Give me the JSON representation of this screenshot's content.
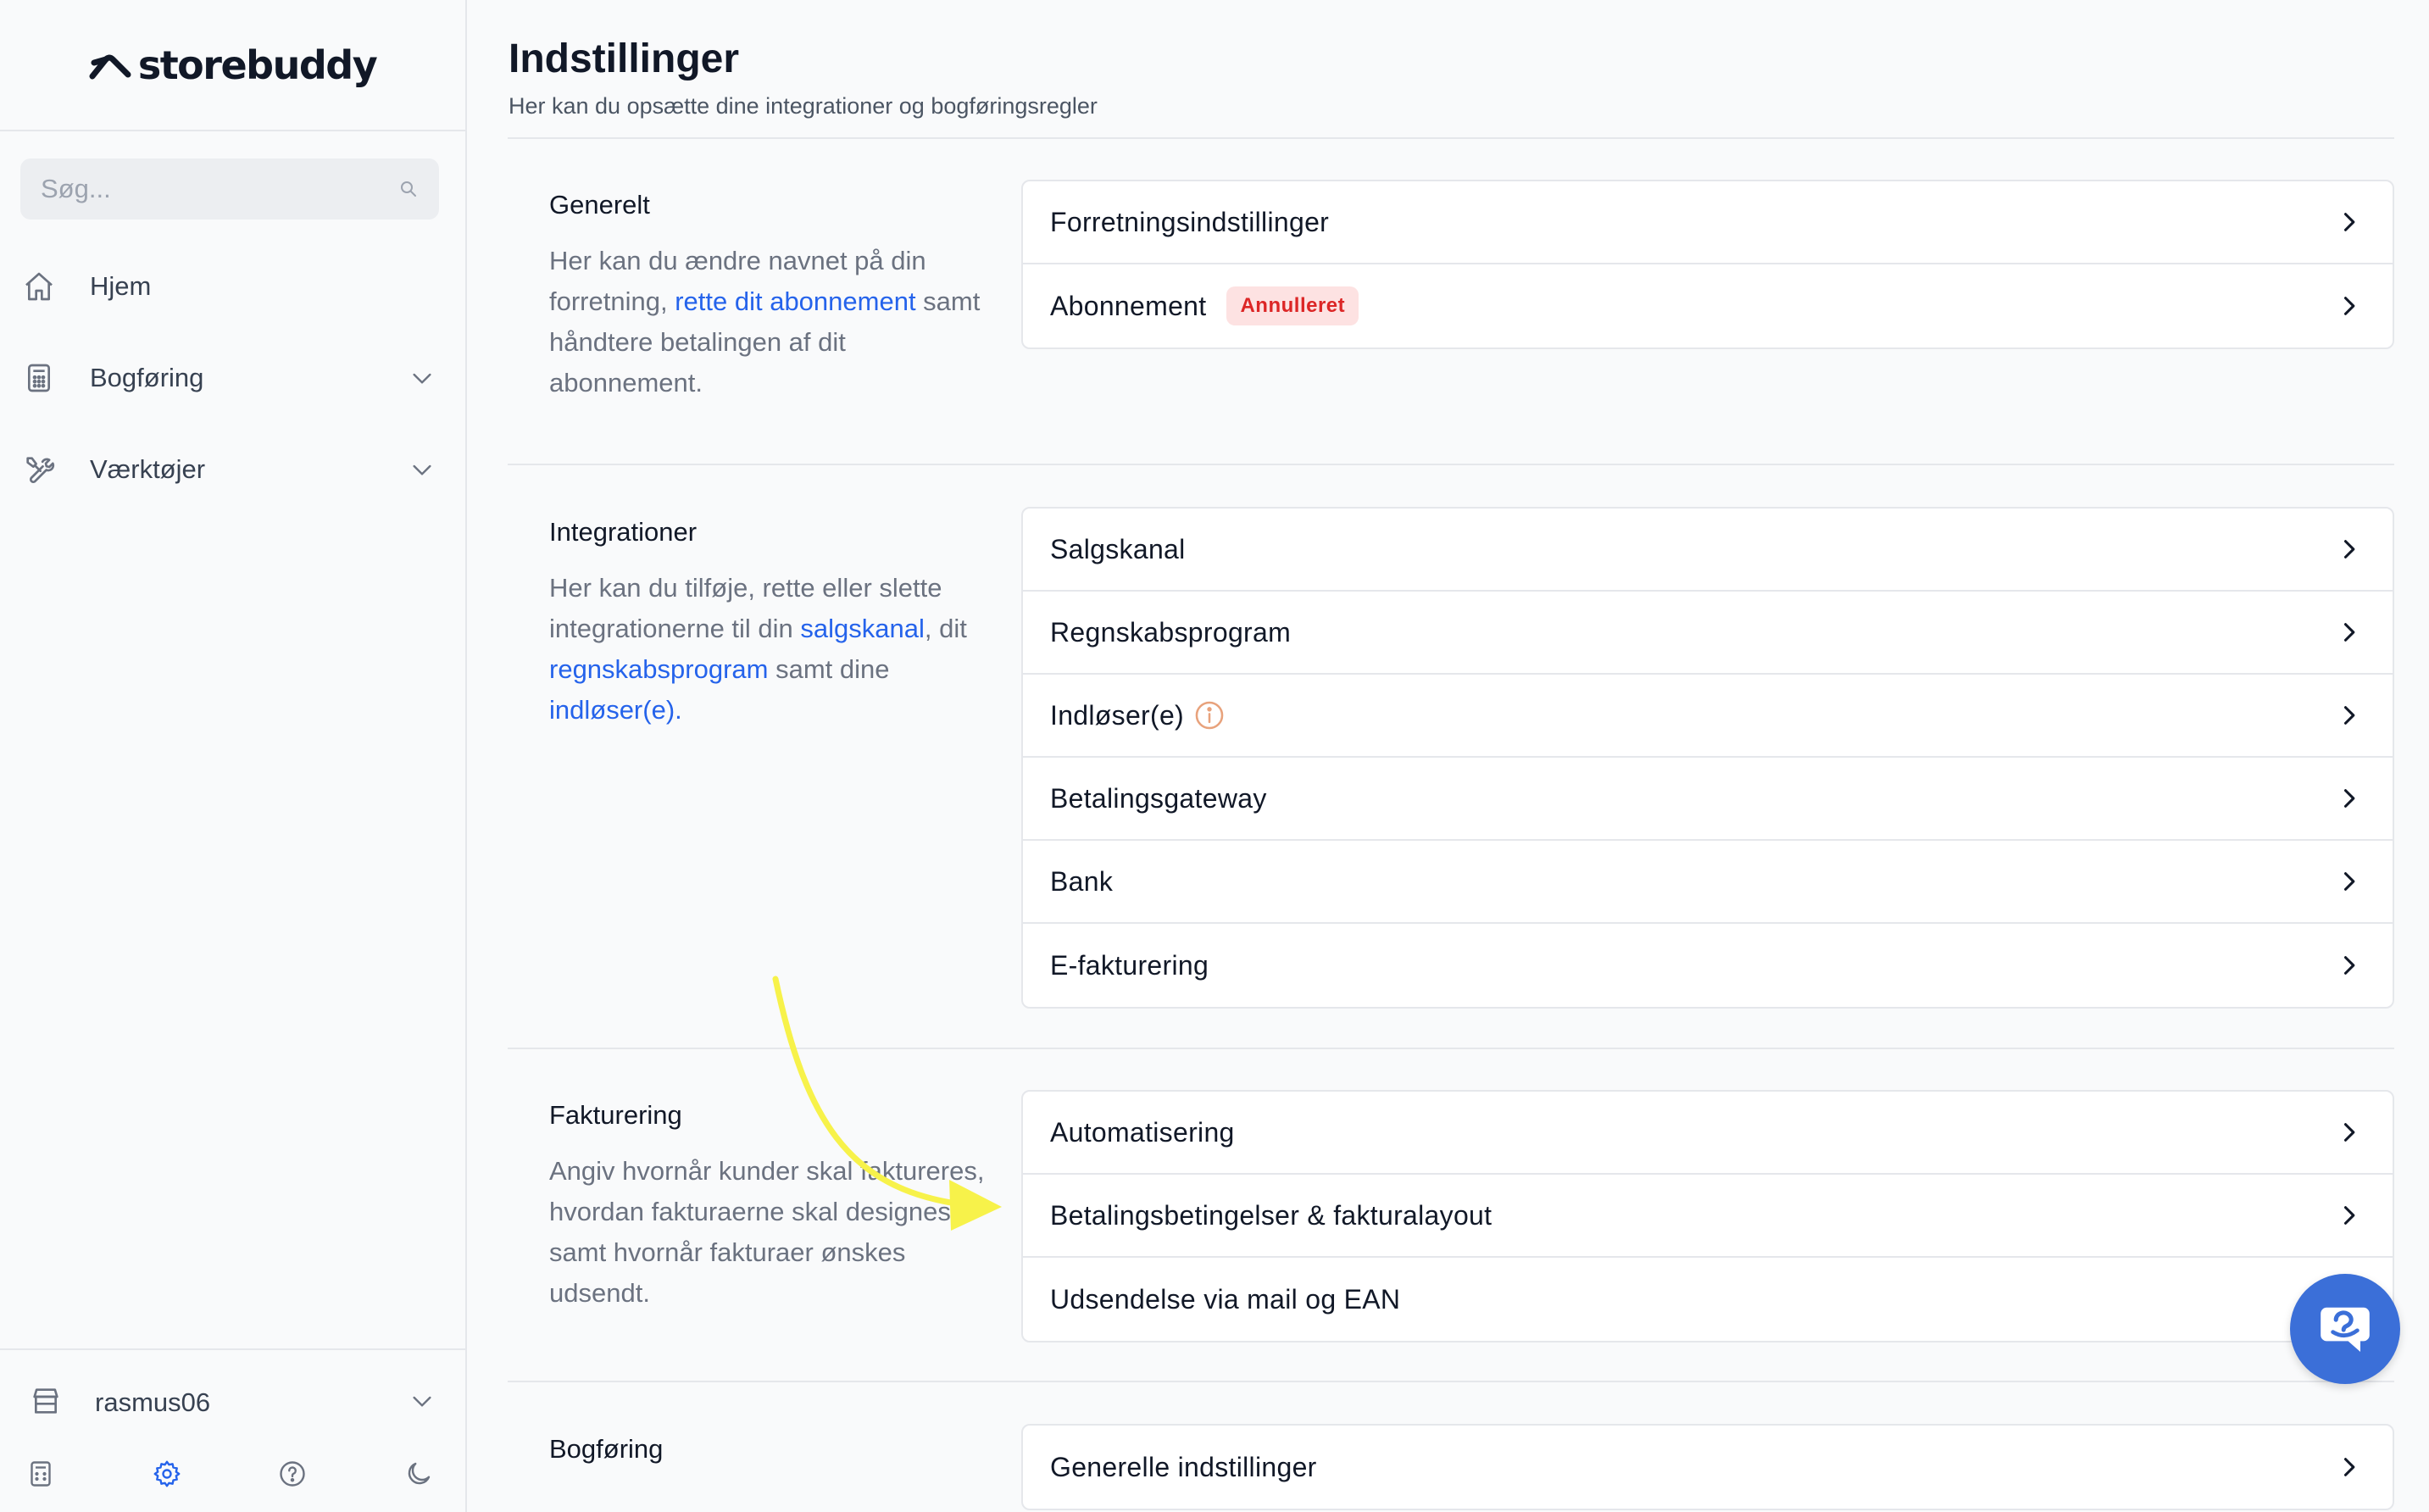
{
  "app": {
    "logo_text": "storebuddy"
  },
  "sidebar": {
    "search_placeholder": "Søg...",
    "nav": [
      {
        "label": "Hjem",
        "icon": "home-icon"
      },
      {
        "label": "Bogføring",
        "icon": "calculator-icon"
      },
      {
        "label": "Værktøjer",
        "icon": "tools-icon"
      }
    ],
    "user": {
      "name": "rasmus06"
    },
    "footer_icons": [
      "calculator-icon",
      "gear-icon",
      "help-icon",
      "moon-icon"
    ]
  },
  "page": {
    "title": "Indstillinger",
    "subtitle": "Her kan du opsætte dine integrationer og bogføringsregler"
  },
  "sections": {
    "generelt": {
      "title": "Generelt",
      "desc_1": "Her kan du ændre navnet på din forretning, ",
      "desc_link": "rette dit abonnement",
      "desc_2": " samt håndtere betalingen af dit abonnement.",
      "rows": [
        {
          "label": "Forretningsindstillinger"
        },
        {
          "label": "Abonnement",
          "badge": "Annulleret"
        }
      ]
    },
    "integrationer": {
      "title": "Integrationer",
      "desc_1": "Her kan du tilføje, rette eller slette integrationerne til din ",
      "link_1": "salgskanal",
      "desc_2": ", dit ",
      "link_2": "regnskabsprogram",
      "desc_3": " samt dine ",
      "link_3": "indløser(e).",
      "rows": [
        {
          "label": "Salgskanal"
        },
        {
          "label": "Regnskabsprogram"
        },
        {
          "label": "Indløser(e)"
        },
        {
          "label": "Betalingsgateway"
        },
        {
          "label": "Bank"
        },
        {
          "label": "E-fakturering"
        }
      ]
    },
    "fakturering": {
      "title": "Fakturering",
      "desc": "Angiv hvornår kunder skal faktureres, hvordan fakturaerne skal designes samt hvornår fakturaer ønskes udsendt.",
      "rows": [
        {
          "label": "Automatisering"
        },
        {
          "label": "Betalingsbetingelser & fakturalayout"
        },
        {
          "label": "Udsendelse via mail og EAN"
        }
      ]
    },
    "bogforing": {
      "title": "Bogføring",
      "rows": [
        {
          "label": "Generelle indstillinger"
        }
      ]
    }
  },
  "colors": {
    "link": "#2563eb",
    "badge_bg": "#fde2e2",
    "badge_text": "#dc2626",
    "annotation_arrow": "#f7f24a",
    "chat_button": "#3b6fd8"
  }
}
